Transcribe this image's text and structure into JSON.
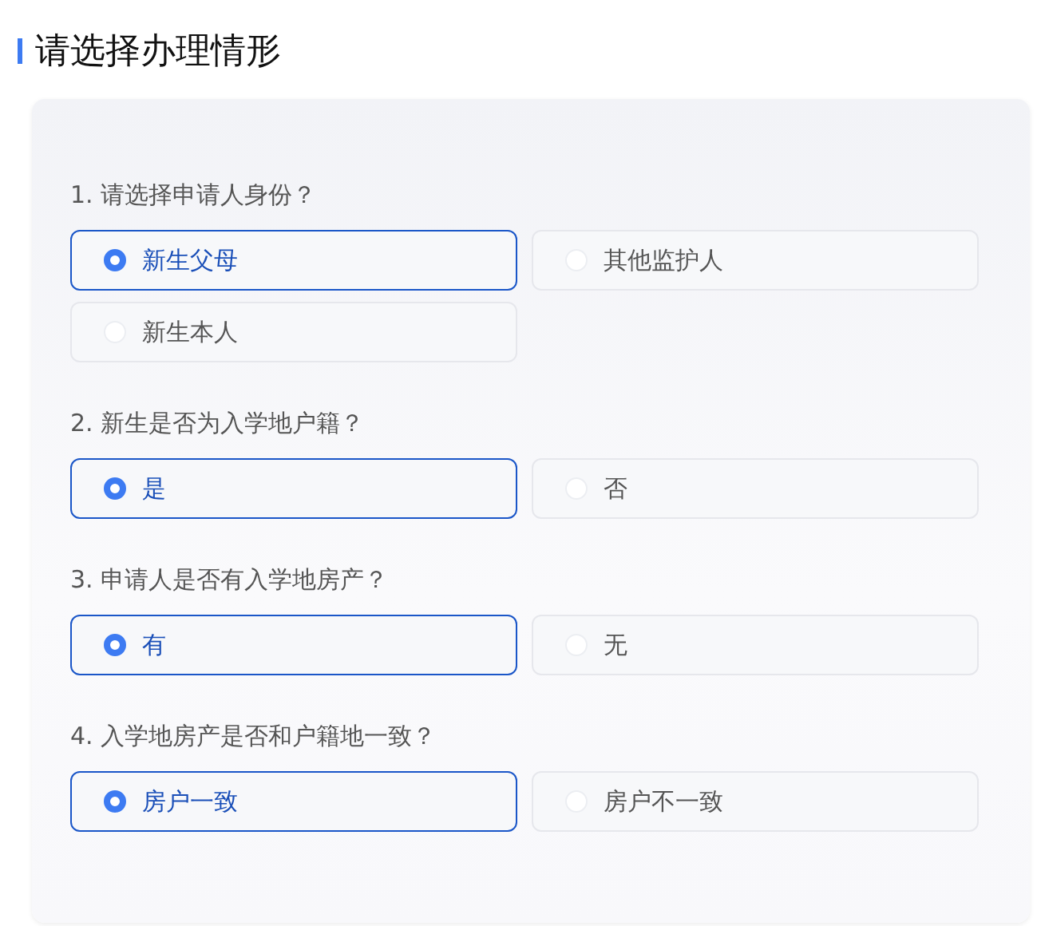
{
  "title": "请选择办理情形",
  "questions": [
    {
      "label": "1. 请选择申请人身份？",
      "options": [
        {
          "label": "新生父母",
          "selected": true
        },
        {
          "label": "其他监护人",
          "selected": false
        },
        {
          "label": "新生本人",
          "selected": false
        }
      ]
    },
    {
      "label": "2. 新生是否为入学地户籍？",
      "options": [
        {
          "label": "是",
          "selected": true
        },
        {
          "label": "否",
          "selected": false
        }
      ]
    },
    {
      "label": "3. 申请人是否有入学地房产？",
      "options": [
        {
          "label": "有",
          "selected": true
        },
        {
          "label": "无",
          "selected": false
        }
      ]
    },
    {
      "label": "4. 入学地房产是否和户籍地一致？",
      "options": [
        {
          "label": "房户一致",
          "selected": true
        },
        {
          "label": "房户不一致",
          "selected": false
        }
      ]
    }
  ]
}
